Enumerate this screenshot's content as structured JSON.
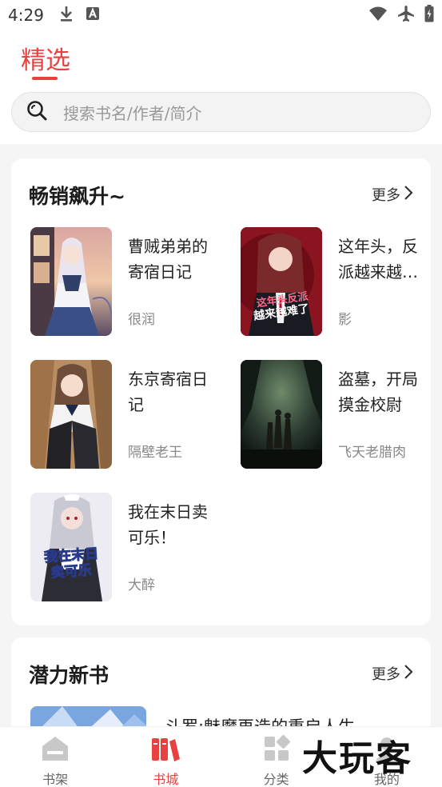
{
  "status_bar": {
    "time": "4:29",
    "left_icons": [
      "download-icon",
      "a-notification-icon"
    ],
    "right_icons": [
      "wifi-icon",
      "airplane-icon",
      "battery-icon"
    ]
  },
  "header": {
    "active_tab": "精选",
    "accent_color": "#e8423f"
  },
  "search": {
    "placeholder": "搜索书名/作者/简介"
  },
  "sections": [
    {
      "title": "畅销飙升~",
      "more_label": "更多",
      "books": [
        {
          "title": "曹贼弟弟的寄宿日记",
          "author": "很润"
        },
        {
          "title": "这年头，反派越来越难了",
          "author": "影",
          "cover_text": [
            "这年头反派",
            "越来越难了"
          ]
        },
        {
          "title": "东京寄宿日记",
          "author": "隔壁老王"
        },
        {
          "title": "盗墓，开局摸金校尉",
          "author": "飞天老腊肉"
        },
        {
          "title": "我在末日卖可乐！",
          "author": "大醉",
          "cover_text": [
            "我在末日",
            "卖可乐"
          ]
        }
      ]
    },
    {
      "title": "潜力新书",
      "more_label": "更多",
      "books": [
        {
          "title": "斗罗:魅魔再造的重启人生"
        }
      ]
    }
  ],
  "bottom_nav": [
    {
      "label": "书架",
      "icon": "bookshelf-icon",
      "active": false
    },
    {
      "label": "书城",
      "icon": "bookstore-icon",
      "active": true
    },
    {
      "label": "分类",
      "icon": "category-icon",
      "active": false
    },
    {
      "label": "我的",
      "icon": "profile-icon",
      "active": false
    }
  ],
  "watermark": "大玩客"
}
